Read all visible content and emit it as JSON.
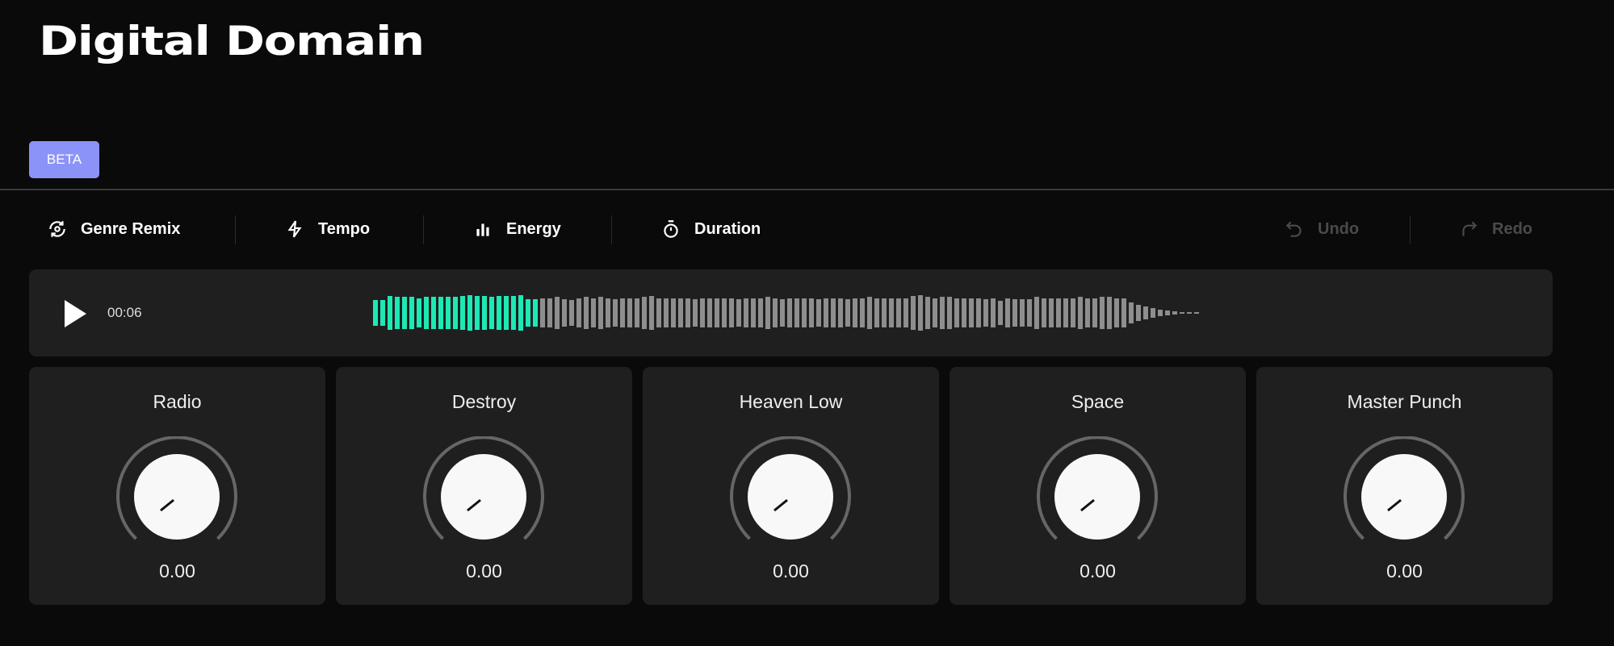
{
  "app_title": "Digital Domain",
  "badge": "BETA",
  "toolbar": {
    "genre_remix": "Genre Remix",
    "tempo": "Tempo",
    "energy": "Energy",
    "duration": "Duration",
    "undo": "Undo",
    "redo": "Redo"
  },
  "player": {
    "time": "00:06",
    "progress": 0.2,
    "played_color": "#1de9b6",
    "unplayed_color": "#8e8e8e",
    "levels": [
      0.7,
      0.7,
      0.9,
      0.85,
      0.85,
      0.85,
      0.8,
      0.85,
      0.85,
      0.85,
      0.85,
      0.85,
      0.9,
      0.95,
      0.9,
      0.9,
      0.85,
      0.9,
      0.9,
      0.9,
      0.95,
      0.75,
      0.75,
      0.8,
      0.8,
      0.85,
      0.75,
      0.7,
      0.8,
      0.85,
      0.8,
      0.85,
      0.8,
      0.75,
      0.8,
      0.8,
      0.8,
      0.85,
      0.9,
      0.8,
      0.8,
      0.8,
      0.8,
      0.8,
      0.75,
      0.8,
      0.8,
      0.8,
      0.8,
      0.8,
      0.75,
      0.8,
      0.8,
      0.8,
      0.85,
      0.8,
      0.75,
      0.8,
      0.8,
      0.8,
      0.8,
      0.75,
      0.8,
      0.8,
      0.8,
      0.75,
      0.8,
      0.8,
      0.85,
      0.8,
      0.8,
      0.8,
      0.8,
      0.8,
      0.9,
      0.95,
      0.85,
      0.8,
      0.85,
      0.85,
      0.8,
      0.8,
      0.8,
      0.8,
      0.75,
      0.8,
      0.65,
      0.8,
      0.75,
      0.75,
      0.75,
      0.85,
      0.8,
      0.8,
      0.8,
      0.8,
      0.8,
      0.85,
      0.8,
      0.8,
      0.85,
      0.85,
      0.8,
      0.8,
      0.55,
      0.45,
      0.35,
      0.25,
      0.18,
      0.12,
      0.08,
      0.05,
      0.04,
      0.03
    ]
  },
  "knobs": [
    {
      "label": "Radio",
      "value": "0.00"
    },
    {
      "label": "Destroy",
      "value": "0.00"
    },
    {
      "label": "Heaven Low",
      "value": "0.00"
    },
    {
      "label": "Space",
      "value": "0.00"
    },
    {
      "label": "Master Punch",
      "value": "0.00"
    }
  ]
}
